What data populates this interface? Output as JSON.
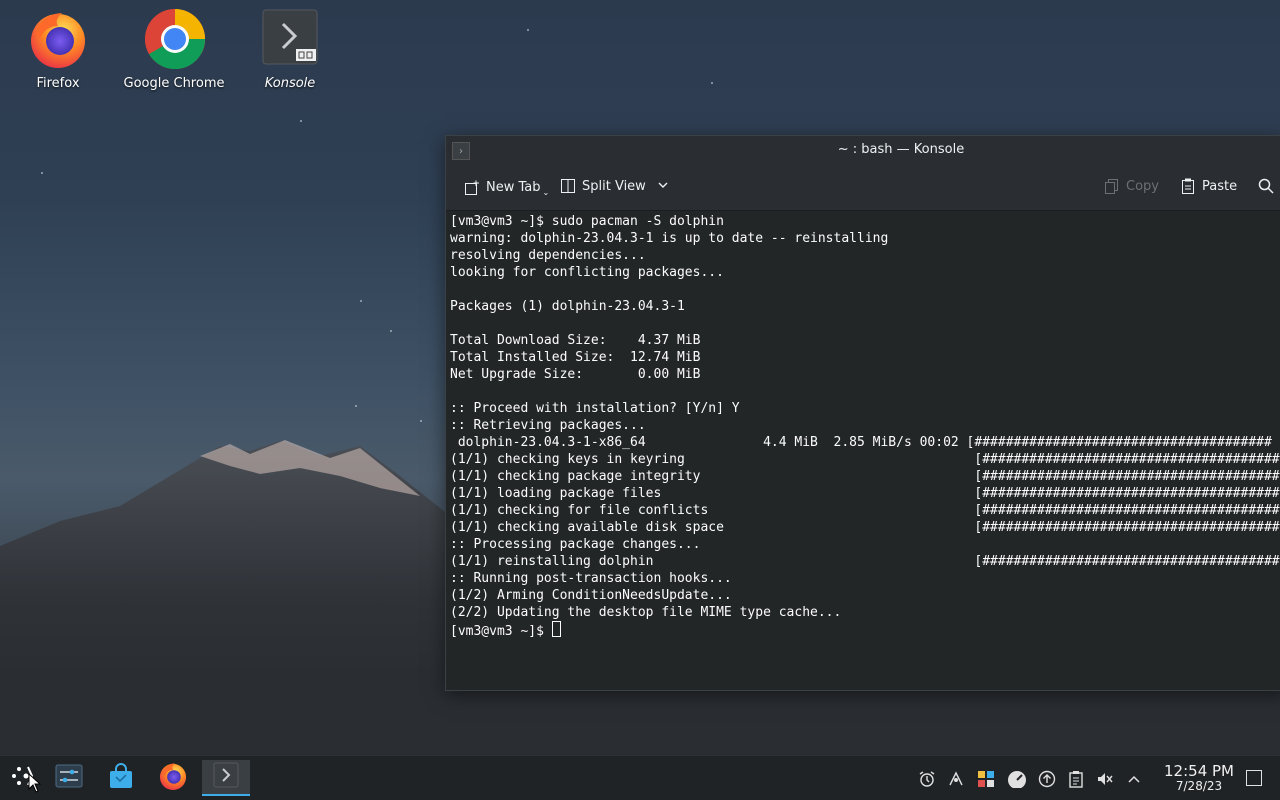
{
  "desktop": {
    "icons": [
      {
        "label": "Firefox"
      },
      {
        "label": "Google Chrome"
      },
      {
        "label": "Konsole"
      }
    ]
  },
  "window": {
    "title": "~ : bash — Konsole",
    "toolbar": {
      "new_tab": "New Tab",
      "split_view": "Split View",
      "copy": "Copy",
      "paste": "Paste"
    },
    "terminal_lines": [
      "[vm3@vm3 ~]$ sudo pacman -S dolphin",
      "warning: dolphin-23.04.3-1 is up to date -- reinstalling",
      "resolving dependencies...",
      "looking for conflicting packages...",
      "",
      "Packages (1) dolphin-23.04.3-1",
      "",
      "Total Download Size:    4.37 MiB",
      "Total Installed Size:  12.74 MiB",
      "Net Upgrade Size:       0.00 MiB",
      "",
      ":: Proceed with installation? [Y/n] Y",
      ":: Retrieving packages...",
      " dolphin-23.04.3-1-x86_64               4.4 MiB  2.85 MiB/s 00:02 [######################################",
      "(1/1) checking keys in keyring                                     [######################################",
      "(1/1) checking package integrity                                   [######################################",
      "(1/1) loading package files                                        [######################################",
      "(1/1) checking for file conflicts                                  [######################################",
      "(1/1) checking available disk space                                [######################################",
      ":: Processing package changes...",
      "(1/1) reinstalling dolphin                                         [######################################",
      ":: Running post-transaction hooks...",
      "(1/2) Arming ConditionNeedsUpdate...",
      "(2/2) Updating the desktop file MIME type cache...",
      "[vm3@vm3 ~]$ "
    ]
  },
  "taskbar": {
    "clock_time": "12:54 PM",
    "clock_date": "7/28/23"
  },
  "colors": {
    "accent": "#3daee9",
    "terminal_bg": "#232627",
    "terminal_fg": "#fcfcfc"
  }
}
